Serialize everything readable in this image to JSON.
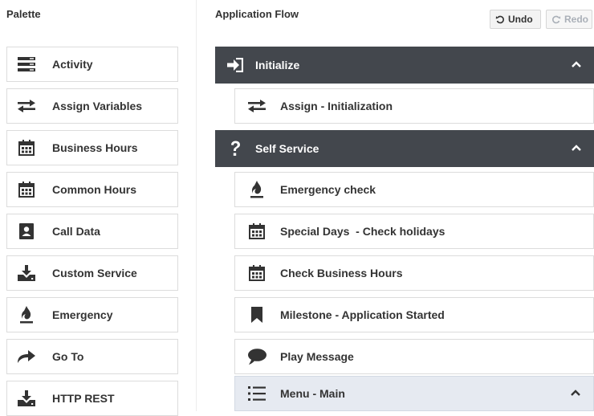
{
  "palette": {
    "title": "Palette",
    "items": [
      {
        "label": "Activity",
        "icon": "activity-icon"
      },
      {
        "label": "Assign Variables",
        "icon": "swap-arrows-icon"
      },
      {
        "label": "Business Hours",
        "icon": "calendar-icon"
      },
      {
        "label": "Common Hours",
        "icon": "calendar-icon"
      },
      {
        "label": "Call Data",
        "icon": "contact-card-icon"
      },
      {
        "label": "Custom Service",
        "icon": "download-tray-icon"
      },
      {
        "label": "Emergency",
        "icon": "fire-icon"
      },
      {
        "label": "Go To",
        "icon": "forward-arrow-icon"
      },
      {
        "label": "HTTP REST",
        "icon": "download-tray-icon"
      }
    ]
  },
  "flow": {
    "title": "Application Flow",
    "toolbar": {
      "undo_label": "Undo",
      "redo_label": "Redo"
    },
    "sections": [
      {
        "label": "Initialize",
        "icon": "sign-in-icon"
      },
      {
        "label": "Self Service",
        "icon": "question-mark-icon"
      }
    ],
    "items": [
      {
        "label": "Assign - Initialization",
        "icon": "swap-arrows-icon"
      },
      {
        "label": "Emergency check",
        "icon": "fire-icon"
      },
      {
        "label": "Special Days  - Check holidays",
        "icon": "calendar-icon"
      },
      {
        "label": "Check Business Hours",
        "icon": "calendar-icon"
      },
      {
        "label": "Milestone - Application Started",
        "icon": "bookmark-icon"
      },
      {
        "label": "Play Message",
        "icon": "speech-bubble-icon"
      },
      {
        "label": "Menu - Main",
        "icon": "menu-list-icon",
        "selected": true
      }
    ]
  },
  "colors": {
    "section_bg": "#43474d",
    "selected_bg": "#e6eaf1",
    "border": "#dcdcdc",
    "text": "#333333"
  }
}
